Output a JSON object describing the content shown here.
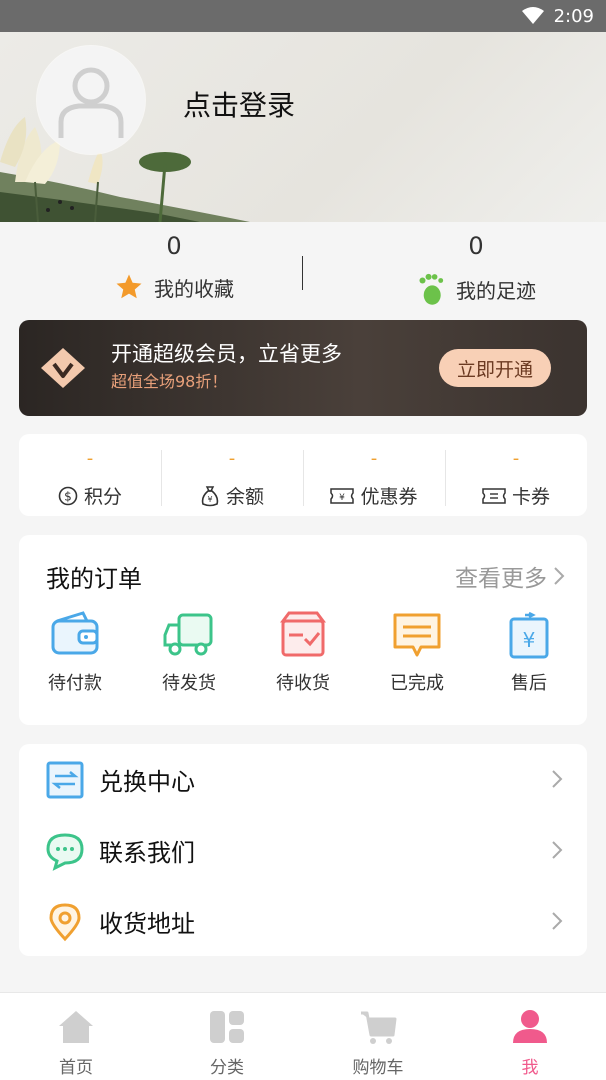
{
  "status_bar": {
    "time": "2:09"
  },
  "profile": {
    "login_text": "点击登录"
  },
  "stats": [
    {
      "count": "0",
      "label": "我的收藏",
      "icon": "star-icon"
    },
    {
      "count": "0",
      "label": "我的足迹",
      "icon": "footprint-icon"
    }
  ],
  "vip": {
    "title": "开通超级会员，立省更多",
    "subtitle": "超值全场98折！",
    "button": "立即开通",
    "colors": {
      "accent": "#f8d0b6",
      "subtitle": "#e8a07a"
    }
  },
  "assets": [
    {
      "value": "-",
      "label": "积分",
      "icon": "points-icon"
    },
    {
      "value": "-",
      "label": "余额",
      "icon": "money-bag-icon"
    },
    {
      "value": "-",
      "label": "优惠券",
      "icon": "coupon-icon"
    },
    {
      "value": "-",
      "label": "卡券",
      "icon": "card-ticket-icon"
    }
  ],
  "orders": {
    "title": "我的订单",
    "more": "查看更多",
    "items": [
      {
        "label": "待付款",
        "icon": "wallet-icon",
        "color": "#4aa8e8"
      },
      {
        "label": "待发货",
        "icon": "truck-icon",
        "color": "#3cc48a"
      },
      {
        "label": "待收货",
        "icon": "package-icon",
        "color": "#f06a6a"
      },
      {
        "label": "已完成",
        "icon": "message-done-icon",
        "color": "#f0a030"
      },
      {
        "label": "售后",
        "icon": "refund-icon",
        "color": "#4aa8e8"
      }
    ]
  },
  "menu": [
    {
      "label": "兑换中心",
      "icon": "exchange-icon",
      "color": "#4aa8e8"
    },
    {
      "label": "联系我们",
      "icon": "chat-icon",
      "color": "#3cc48a"
    },
    {
      "label": "收货地址",
      "icon": "location-icon",
      "color": "#f0a030"
    }
  ],
  "bottom_nav": [
    {
      "label": "首页",
      "icon": "home-icon",
      "active": false
    },
    {
      "label": "分类",
      "icon": "category-icon",
      "active": false
    },
    {
      "label": "购物车",
      "icon": "cart-icon",
      "active": false
    },
    {
      "label": "我",
      "icon": "user-icon",
      "active": true
    }
  ],
  "colors": {
    "active_nav": "#f05a8c",
    "inactive_nav": "#cfcfcf"
  }
}
